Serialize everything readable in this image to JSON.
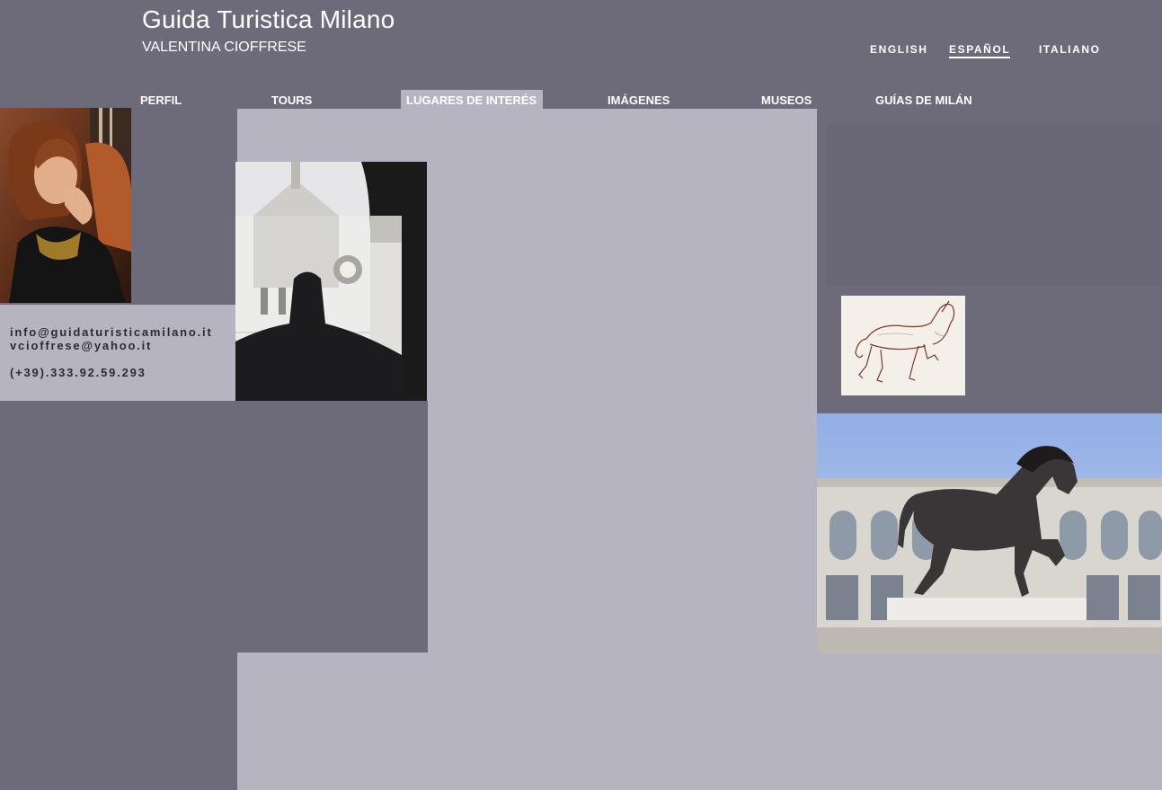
{
  "header": {
    "title": "Guida Turistica Milano",
    "subtitle": "VALENTINA CIOFFRESE"
  },
  "languages": [
    {
      "label": "ENGLISH",
      "active": false
    },
    {
      "label": "ESPAÑOL",
      "active": true
    },
    {
      "label": "ITALIANO",
      "active": false
    }
  ],
  "nav": [
    {
      "label": "PERFIL"
    },
    {
      "label": "TOURS"
    },
    {
      "label": "LUGARES DE INTERÉS",
      "active": true
    },
    {
      "label": "IMÁGENES"
    },
    {
      "label": "MUSEOS"
    },
    {
      "label": "GUÍAS DE MILÁN"
    }
  ],
  "contact": {
    "email1": "info@guidaturisticamilano.it",
    "email2": "vcioffrese@yahoo.it",
    "phone": "(+39).333.92.59.293"
  },
  "images": {
    "portrait": "portrait-photo",
    "cemetery": "monumental-cemetery-photo",
    "sketch": "leonardo-horse-sketch",
    "horse": "leonardo-horse-statue-photo"
  },
  "colors": {
    "background": "#6d6a79",
    "panel": "#b7b4c1",
    "text_light": "#ffffff",
    "text_dark": "#2c2a33"
  }
}
